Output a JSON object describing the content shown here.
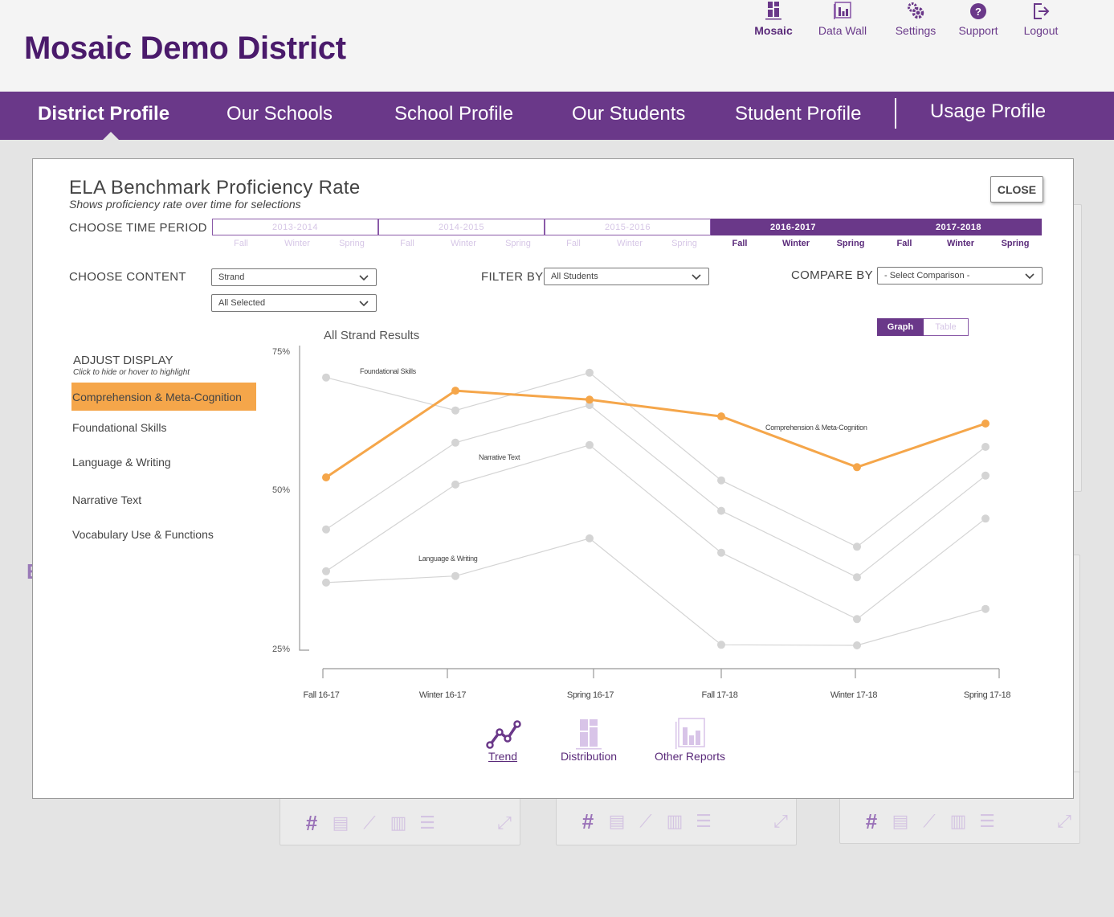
{
  "header": {
    "title": "Mosaic Demo District",
    "nav": [
      {
        "label": "Mosaic",
        "icon": "mosaic-icon",
        "active": true
      },
      {
        "label": "Data Wall",
        "icon": "data-wall-icon",
        "active": false
      },
      {
        "label": "Settings",
        "icon": "gear-icon",
        "active": false
      },
      {
        "label": "Support",
        "icon": "help-icon",
        "active": false
      },
      {
        "label": "Logout",
        "icon": "logout-icon",
        "active": false
      }
    ]
  },
  "main_nav": [
    {
      "label": "District Profile",
      "active": true
    },
    {
      "label": "Our Schools",
      "active": false
    },
    {
      "label": "School Profile",
      "active": false
    },
    {
      "label": "Our Students",
      "active": false
    },
    {
      "label": "Student Profile",
      "active": false
    },
    {
      "label": "Usage Profile",
      "active": false
    }
  ],
  "modal": {
    "title": "ELA Benchmark Proficiency Rate",
    "subtitle": "Shows proficiency rate over time for selections",
    "close_label": "CLOSE",
    "time_period_label": "CHOOSE TIME PERIOD",
    "years": [
      {
        "label": "2013-2014",
        "selected": false,
        "seasons": [
          "Fall",
          "Winter",
          "Spring"
        ]
      },
      {
        "label": "2014-2015",
        "selected": false,
        "seasons": [
          "Fall",
          "Winter",
          "Spring"
        ]
      },
      {
        "label": "2015-2016",
        "selected": false,
        "seasons": [
          "Fall",
          "Winter",
          "Spring"
        ]
      },
      {
        "label": "2016-2017",
        "selected": true,
        "seasons": [
          "Fall",
          "Winter",
          "Spring"
        ]
      },
      {
        "label": "2017-2018",
        "selected": true,
        "seasons": [
          "Fall",
          "Winter",
          "Spring"
        ]
      }
    ],
    "content_label": "CHOOSE CONTENT",
    "content_select": "Strand",
    "content_sub_select": "All Selected",
    "filter_label": "FILTER BY",
    "filter_select": "All Students",
    "compare_label": "COMPARE BY",
    "compare_select": "- Select Comparison -",
    "view_toggle": {
      "graph": "Graph",
      "table": "Table",
      "selected": "Graph"
    },
    "adjust_display": {
      "title": "ADJUST DISPLAY",
      "hint": "Click to hide or hover to highlight",
      "items": [
        {
          "label": "Comprehension & Meta-Cognition",
          "highlighted": true
        },
        {
          "label": "Foundational Skills",
          "highlighted": false
        },
        {
          "label": "Language & Writing",
          "highlighted": false
        },
        {
          "label": "Narrative Text",
          "highlighted": false
        },
        {
          "label": "Vocabulary Use & Functions",
          "highlighted": false
        }
      ]
    },
    "report_tabs": [
      {
        "label": "Trend",
        "icon": "trend-icon",
        "active": true
      },
      {
        "label": "Distribution",
        "icon": "distribution-icon",
        "active": false
      },
      {
        "label": "Other Reports",
        "icon": "bar-chart-icon",
        "active": false
      }
    ]
  },
  "colors": {
    "brand_purple": "#6a3889",
    "title_purple": "#4a1a6b",
    "highlight_orange": "#f5a64a",
    "muted_series": "#d4d4d4"
  },
  "chart_data": {
    "type": "line",
    "title": "All Strand Results",
    "xlabel": "",
    "ylabel": "",
    "categories": [
      "Fall 16-17",
      "Winter 16-17",
      "Spring 16-17",
      "Fall 17-18",
      "Winter 17-18",
      "Spring 17-18"
    ],
    "y_ticks": [
      "75%",
      "50%",
      "25%"
    ],
    "y_tick_values": [
      75,
      50,
      25
    ],
    "ylim": [
      25,
      75
    ],
    "grid": false,
    "legend": "left",
    "highlighted_series": "Comprehension & Meta-Cognition",
    "series": [
      {
        "name": "Foundational Skills",
        "label_text": "Foundational Skills",
        "values": [
          70.6,
          65.1,
          71.4,
          53.4,
          42.3,
          59.0
        ]
      },
      {
        "name": "Vocabulary Use & Functions",
        "label_text": "",
        "values": [
          45.2,
          59.7,
          66.0,
          48.3,
          37.2,
          54.2
        ]
      },
      {
        "name": "Narrative Text",
        "label_text": "Narrative Text",
        "values": [
          38.2,
          52.7,
          59.3,
          41.3,
          30.2,
          47.0
        ]
      },
      {
        "name": "Language & Writing",
        "label_text": "Language & Writing",
        "values": [
          36.3,
          37.4,
          43.7,
          25.9,
          25.8,
          31.9
        ]
      },
      {
        "name": "Comprehension & Meta-Cognition",
        "label_text": "Comprehension & Meta-Cognition",
        "values": [
          53.9,
          68.4,
          66.9,
          64.1,
          55.6,
          62.9
        ]
      }
    ]
  }
}
